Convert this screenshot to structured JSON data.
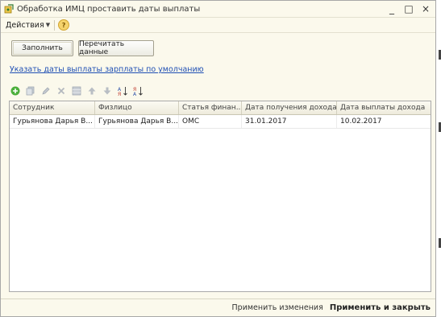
{
  "window": {
    "title": "Обработка  ИМЦ проставить даты выплаты",
    "controls": [
      "_",
      "□",
      "×"
    ]
  },
  "menu": {
    "actions_label": "Действия",
    "help_label": "?"
  },
  "buttons": {
    "fill_label": "Заполнить",
    "reread_label": "Перечитать данные"
  },
  "link": {
    "set_dates_label": "Указать даты выплаты зарплаты по умолчанию"
  },
  "toolbar": {
    "icons": [
      "add-icon",
      "copy-icon",
      "edit-icon",
      "delete-icon",
      "table-icon",
      "move-up-icon",
      "move-down-icon",
      "sort-asc-icon",
      "sort-desc-icon"
    ]
  },
  "table": {
    "columns": [
      "Сотрудник",
      "Физлицо",
      "Статья финан...",
      "Дата получения дохода",
      "Дата выплаты дохода"
    ],
    "rows": [
      [
        "Гурьянова Дарья В...",
        "Гурьянова Дарья В...",
        "ОМС",
        "31.01.2017",
        "10.02.2017"
      ]
    ]
  },
  "footer": {
    "apply_label": "Применить изменения",
    "apply_close_label": "Применить и закрыть"
  },
  "colors": {
    "window_bg": "#fbf9ec",
    "link": "#1f4fb4",
    "border": "#a8a8a8"
  }
}
